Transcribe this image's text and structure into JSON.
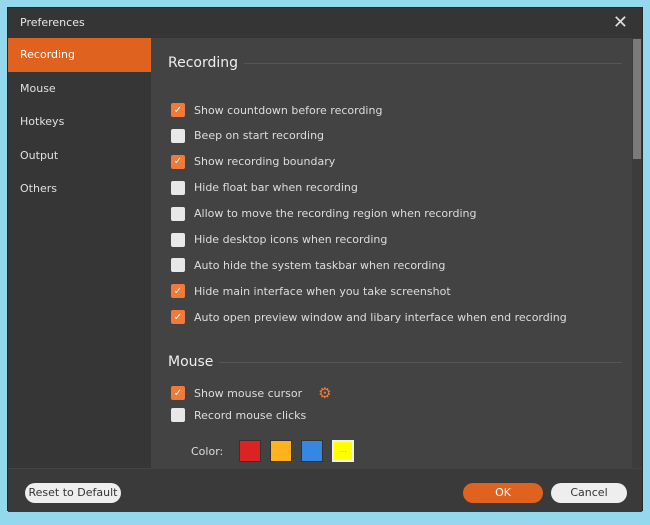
{
  "title": "Preferences",
  "sidebar": {
    "items": [
      {
        "label": "Recording"
      },
      {
        "label": "Mouse"
      },
      {
        "label": "Hotkeys"
      },
      {
        "label": "Output"
      },
      {
        "label": "Others"
      }
    ]
  },
  "recording": {
    "heading": "Recording",
    "options": [
      {
        "label": "Show countdown before recording",
        "checked": true
      },
      {
        "label": "Beep on start recording",
        "checked": false
      },
      {
        "label": "Show recording boundary",
        "checked": true
      },
      {
        "label": "Hide float bar when recording",
        "checked": false
      },
      {
        "label": "Allow to move the recording region when recording",
        "checked": false
      },
      {
        "label": "Hide desktop icons when recording",
        "checked": false
      },
      {
        "label": "Auto hide the system taskbar when recording",
        "checked": false
      },
      {
        "label": "Hide main interface when you take screenshot",
        "checked": true
      },
      {
        "label": "Auto open preview window and libary interface when end recording",
        "checked": true
      }
    ]
  },
  "mouse": {
    "heading": "Mouse",
    "show_cursor": "Show mouse cursor",
    "record_clicks": "Record mouse clicks",
    "color_label": "Color:",
    "colors": [
      "#dd2222",
      "#ffb21c",
      "#3587e2",
      "#ffff00"
    ],
    "more": "···"
  },
  "footer": {
    "reset": "Reset to Default",
    "ok": "OK",
    "cancel": "Cancel"
  },
  "accent": "#e0621f"
}
